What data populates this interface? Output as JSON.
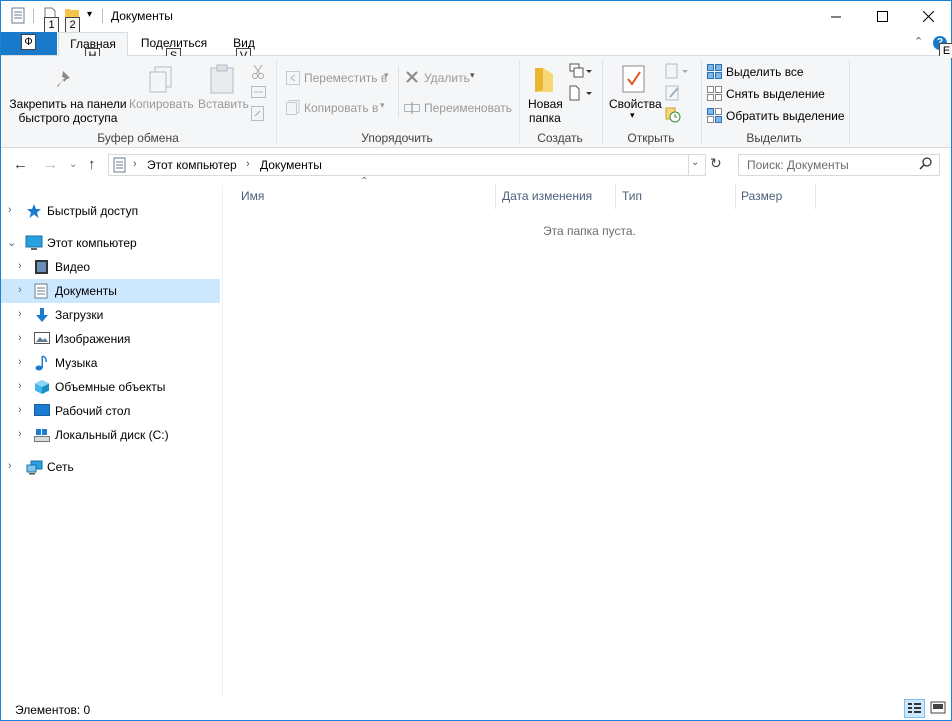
{
  "window": {
    "title": "Документы",
    "qat_keytips": [
      "1",
      "2"
    ]
  },
  "ribbon_tabs": {
    "file": "Ф",
    "file_keytip": "Ф",
    "items": [
      {
        "label": "Главная",
        "keytip": "H"
      },
      {
        "label": "Поделиться",
        "keytip": "S"
      },
      {
        "label": "Вид",
        "keytip": "V"
      }
    ],
    "help_keytip": "E"
  },
  "ribbon": {
    "clipboard": {
      "label": "Буфер обмена",
      "pin_line1": "Закрепить на панели",
      "pin_line2": "быстрого доступа",
      "copy": "Копировать",
      "paste": "Вставить"
    },
    "organize": {
      "label": "Упорядочить",
      "move_to": "Переместить в",
      "copy_to": "Копировать в",
      "delete": "Удалить",
      "rename": "Переименовать"
    },
    "new": {
      "label": "Создать",
      "new_folder_line1": "Новая",
      "new_folder_line2": "папка"
    },
    "open": {
      "label": "Открыть",
      "properties": "Свойства"
    },
    "select": {
      "label": "Выделить",
      "select_all": "Выделить все",
      "select_none": "Снять выделение",
      "invert": "Обратить выделение"
    }
  },
  "address": {
    "crumbs": [
      "Этот компьютер",
      "Документы"
    ],
    "search_placeholder": "Поиск: Документы"
  },
  "nav": {
    "quick_access": "Быстрый доступ",
    "this_pc": "Этот компьютер",
    "children": [
      "Видео",
      "Документы",
      "Загрузки",
      "Изображения",
      "Музыка",
      "Объемные объекты",
      "Рабочий стол",
      "Локальный диск (C:)"
    ],
    "network": "Сеть"
  },
  "columns": [
    "Имя",
    "Дата изменения",
    "Тип",
    "Размер"
  ],
  "empty_message": "Эта папка пуста.",
  "status": {
    "items_text": "Элементов: 0"
  },
  "colors": {
    "accent": "#1979ca",
    "selection": "#cce8ff"
  }
}
